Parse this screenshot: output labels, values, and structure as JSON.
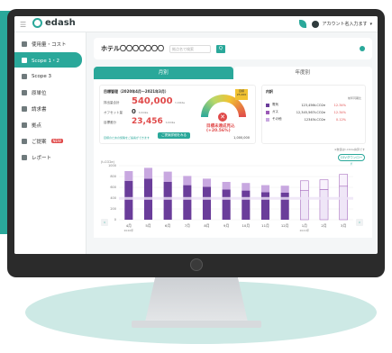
{
  "app": {
    "logo_text": "edash",
    "account_label": "アカウント名入力ます"
  },
  "sidebar": {
    "items": [
      {
        "label": "使用量・コスト",
        "icon": "chart-bars-icon",
        "active": false
      },
      {
        "label": "Scope 1・2",
        "icon": "factory-icon",
        "active": true
      },
      {
        "label": "Scope 3",
        "icon": "truck-icon",
        "active": false
      },
      {
        "label": "原単位",
        "icon": "unit-icon",
        "active": false
      },
      {
        "label": "請求書",
        "icon": "invoice-icon",
        "active": false
      },
      {
        "label": "拠点",
        "icon": "building-icon",
        "active": false
      },
      {
        "label": "ご提案",
        "icon": "lightbulb-icon",
        "active": false,
        "badge": "NEW"
      },
      {
        "label": "レポート",
        "icon": "report-icon",
        "active": false
      }
    ]
  },
  "hotel": {
    "name": "ホテル〇〇〇〇〇〇〇",
    "search_placeholder": "拠点名で検索",
    "search_button": "Q"
  },
  "tabs": {
    "monthly": "月別",
    "yearly": "年度別"
  },
  "goal": {
    "title": "目標管理（2020年4月〜2021年3月）",
    "rows": [
      {
        "label": "排出量合計",
        "value": "540,000",
        "unit": "t-CO2e"
      },
      {
        "label": "オフセット量",
        "value": "0",
        "unit": "t-CO2e"
      },
      {
        "label": "目標差分",
        "value": "23,456",
        "unit": "t-CO2e"
      }
    ],
    "note": "目標のための施策をご提案ができます",
    "button": "ご提案詳細をみる",
    "gauge_label_top": "目標",
    "target_box": "25,000",
    "warning": "目標未達成見込",
    "warning_sub": "(+20.56%)",
    "total": "1,000,000"
  },
  "breakdown": {
    "title": "内訳",
    "header": "前年同期比",
    "rows": [
      {
        "name": "電気",
        "value": "123,456t-CO2e",
        "pct": "12.34%",
        "color": "#6a3d9a"
      },
      {
        "name": "ガス",
        "value": "12,345,567t-CO2e",
        "pct": "12.34%",
        "color": "#9b59b6"
      },
      {
        "name": "その他",
        "value": "12345t-CO2e",
        "pct": "0.12%",
        "color": "#c8a8e0"
      }
    ]
  },
  "chart_note": "※数値はt-CO2e換算です",
  "csv_button": "CSVダウンロード",
  "chart_data": {
    "type": "bar",
    "ylabel": "(t-CO2e)",
    "yticks": [
      0,
      200,
      400,
      600,
      800,
      1000
    ],
    "ylim": [
      0,
      1000
    ],
    "categories": [
      "4月",
      "5月",
      "6月",
      "7月",
      "8月",
      "9月",
      "10月",
      "11月",
      "12月",
      "1月",
      "2月",
      "3月"
    ],
    "category_sub": [
      "2020年",
      "",
      "",
      "",
      "",
      "",
      "",
      "",
      "",
      "2021年",
      "",
      ""
    ],
    "series": [
      {
        "name": "電気",
        "values": [
          720,
          760,
          700,
          640,
          610,
          560,
          540,
          510,
          500,
          540,
          560,
          620
        ]
      },
      {
        "name": "ガス",
        "values": [
          180,
          200,
          190,
          170,
          150,
          140,
          140,
          130,
          130,
          180,
          180,
          220
        ]
      }
    ],
    "target": 420,
    "forecast_from_index": 9
  }
}
